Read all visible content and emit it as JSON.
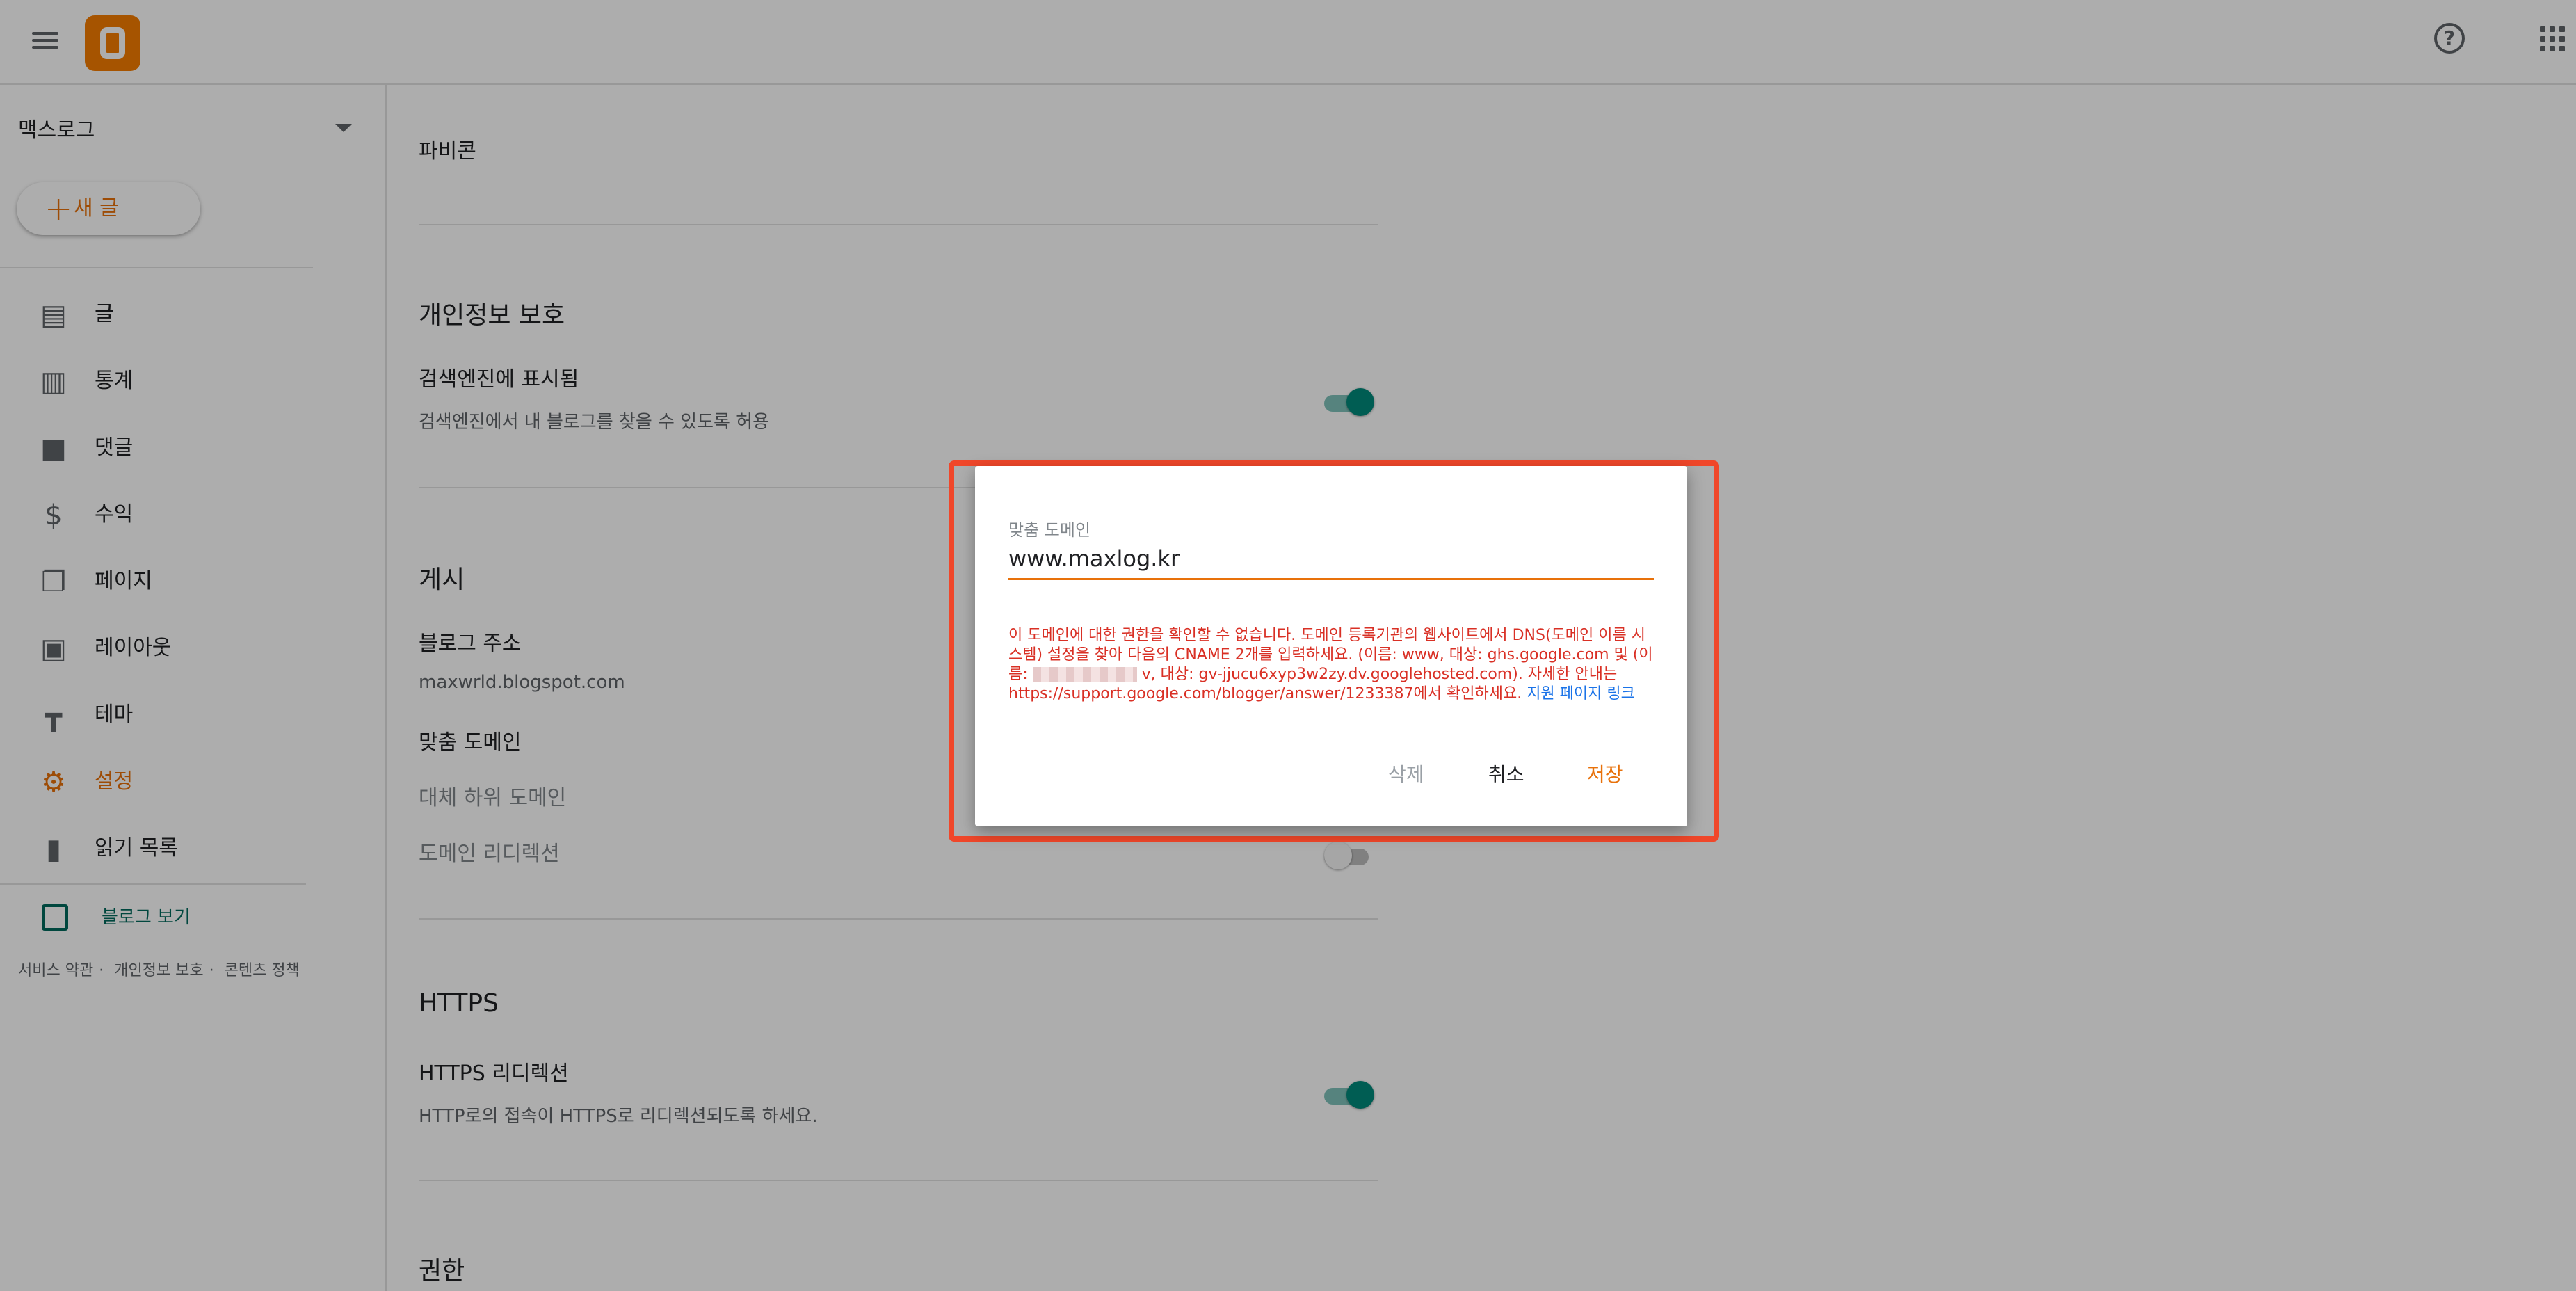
{
  "header": {
    "menu_icon": "hamburger-icon",
    "logo_icon": "blogger-logo-icon",
    "help_icon": "help-icon",
    "apps_icon": "apps-grid-icon"
  },
  "sidebar": {
    "blog_name": "맥스로그",
    "new_post": "새 글",
    "items": [
      {
        "label": "글",
        "icon": "posts-icon"
      },
      {
        "label": "통계",
        "icon": "stats-icon"
      },
      {
        "label": "댓글",
        "icon": "comments-icon"
      },
      {
        "label": "수익",
        "icon": "earnings-icon"
      },
      {
        "label": "페이지",
        "icon": "pages-icon"
      },
      {
        "label": "레이아웃",
        "icon": "layout-icon"
      },
      {
        "label": "테마",
        "icon": "theme-icon"
      },
      {
        "label": "설정",
        "icon": "settings-icon"
      },
      {
        "label": "읽기 목록",
        "icon": "reading-list-icon"
      }
    ],
    "view_blog": "블로그 보기",
    "footer": [
      "서비스 약관",
      "개인정보 보호",
      "콘텐츠 정책"
    ],
    "accent": "#e8710a"
  },
  "content": {
    "favicon": "파비콘",
    "privacy_heading": "개인정보 보호",
    "search_visible_title": "검색엔진에 표시됨",
    "search_visible_sub": "검색엔진에서 내 블로그를 찾을 수 있도록 허용",
    "publish_heading": "게시",
    "blog_address_title": "블로그 주소",
    "blog_address_value": "maxwrld.blogspot.com",
    "custom_domain_title": "맞춤 도메인",
    "fallback_subdomain": "대체 하위 도메인",
    "domain_redirect": "도메인 리디렉션",
    "https_heading": "HTTPS",
    "https_redirect_title": "HTTPS 리디렉션",
    "https_redirect_sub": "HTTP로의 접속이 HTTPS로 리디렉션되도록 하세요.",
    "permissions_heading": "권한"
  },
  "dialog": {
    "label": "맞춤 도메인",
    "value": "www.maxlog.kr",
    "error_part1": "이 도메인에 대한 권한을 확인할 수 없습니다. 도메인 등록기관의 웹사이트에서 DNS(도메인 이름 시스템) 설정을 찾아 다음의 CNAME 2개를 입력하세요. (이름: www, 대상: ghs.google.com 및 (이름: ",
    "error_part2": "v, 대상: gv-jjucu6xyp3w2zy.dv.googlehosted.com). 자세한 안내는 https://support.google.com/blogger/answer/1233387에서 확인하세요.",
    "error_link": "지원 페이지 링크",
    "delete": "삭제",
    "cancel": "취소",
    "save": "저장",
    "error_color": "#d93025",
    "highlight_color": "#f0472a"
  }
}
